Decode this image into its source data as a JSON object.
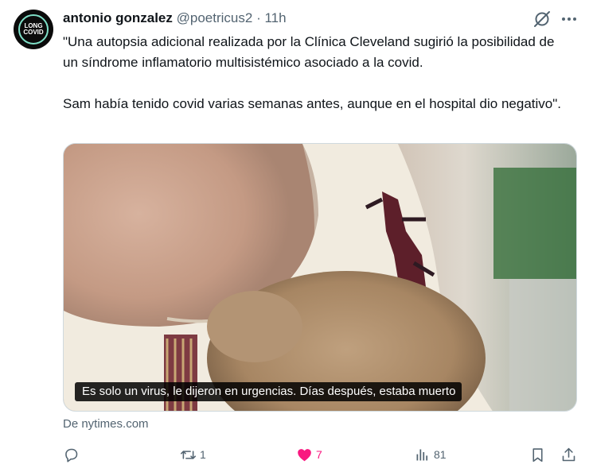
{
  "tweet": {
    "avatar_text": [
      "LONG",
      "COVID"
    ],
    "display_name": "antonio gonzalez",
    "handle": "@poetricus2",
    "separator": "·",
    "time": "11h",
    "text": "\"Una autopsia adicional realizada por la Clínica Cleveland sugirió la posibilidad de un síndrome inflamatorio multisistémico asociado a la covid.\n\n Sam había tenido covid varias semanas antes, aunque en el hospital dio negativo\".",
    "media_caption": "Es solo un virus, le dijeron en urgencias. Días después, estaba muerto",
    "source": "De nytimes.com"
  },
  "actions": {
    "reply_count": "",
    "retweet_count": "1",
    "like_count": "7",
    "views_count": "81"
  },
  "icons": [
    "avatar",
    "grok-icon",
    "more-icon",
    "reply-icon",
    "retweet-icon",
    "heart-icon",
    "views-icon",
    "bookmark-icon",
    "share-icon"
  ],
  "colors": {
    "text": "#0f1419",
    "secondary": "#536471",
    "like": "#f91880"
  }
}
